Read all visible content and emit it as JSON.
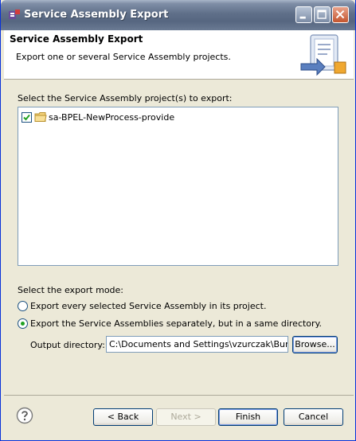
{
  "window": {
    "title": "Service Assembly Export"
  },
  "header": {
    "title": "Service Assembly Export",
    "description": "Export one or several Service Assembly projects."
  },
  "selection": {
    "label": "Select the Service Assembly project(s) to export:",
    "projects": [
      {
        "label": "sa-BPEL-NewProcess-provide",
        "checked": true
      }
    ]
  },
  "export_mode": {
    "label": "Select the export mode:",
    "options": [
      {
        "label": "Export every selected Service Assembly in its project.",
        "selected": false
      },
      {
        "label": "Export the Service Assemblies separately, but in a same directory.",
        "selected": true
      }
    ]
  },
  "output": {
    "label": "Output directory:",
    "value": "C:\\Documents and Settings\\vzurczak\\Bureau",
    "browse_label": "Browse..."
  },
  "footer": {
    "back_label": "< Back",
    "next_label": "Next >",
    "finish_label": "Finish",
    "cancel_label": "Cancel"
  },
  "icons": {
    "app": "eclipse-app-icon",
    "wizard": "export-wizard-icon",
    "help": "help-icon",
    "project": "folder-icon"
  },
  "colors": {
    "titlebar": "#5f6f89",
    "dialog_bg": "#ece9d8",
    "radio_selected": "#21a121",
    "check_mark": "#21a121"
  }
}
